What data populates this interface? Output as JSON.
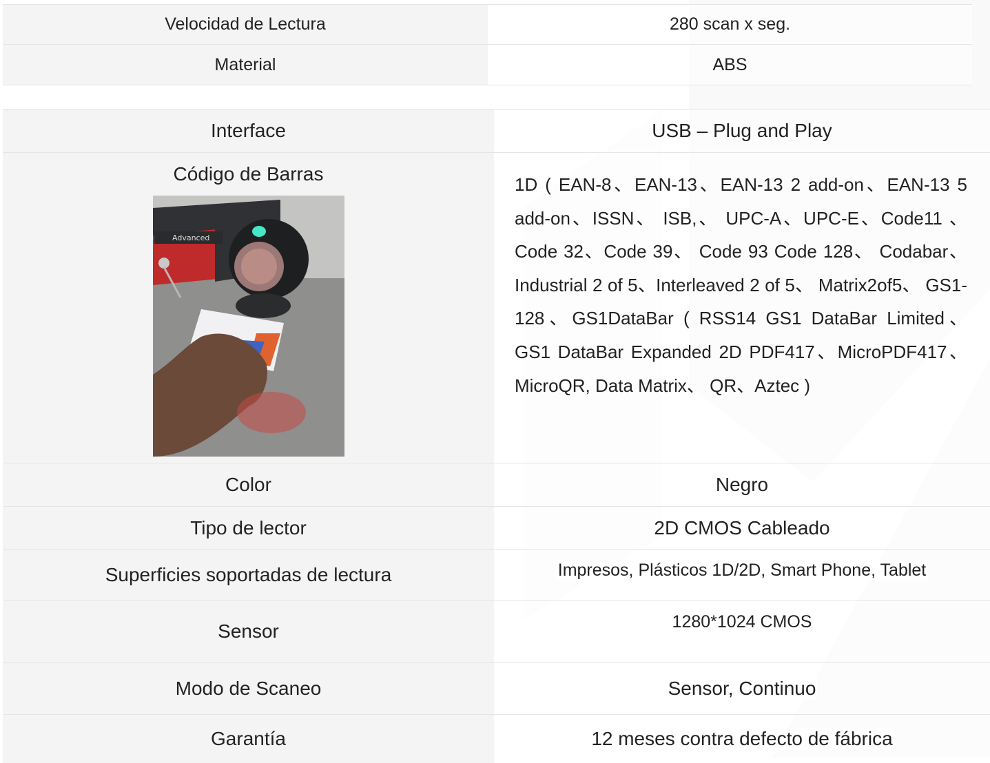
{
  "specs_top": [
    {
      "label": "Velocidad de Lectura",
      "value": "280 scan x seg."
    },
    {
      "label": "Material",
      "value": "ABS"
    }
  ],
  "specs": {
    "interface": {
      "label": "Interface",
      "value": "USB – Plug and Play"
    },
    "barcodes": {
      "label": "Código de Barras",
      "value": "1D ( EAN-8、EAN-13、EAN-13 2 add-on、EAN-13 5 add-on、ISSN、 ISB,、 UPC-A、UPC-E、Code11 、Code 32、Code 39、 Code 93 Code 128、 Codabar、Industrial 2 of 5、Interleaved 2 of 5、 Matrix2of5、 GS1-128、GS1DataBar ( RSS14 GS1 DataBar Limited、 GS1 DataBar Expanded 2D PDF417、MicroPDF417、MicroQR, Data Matrix、 QR、Aztec )",
      "photo_brand": "Advanced"
    },
    "color": {
      "label": "Color",
      "value": "Negro"
    },
    "reader_type": {
      "label": "Tipo de lector",
      "value": "2D CMOS Cableado"
    },
    "surfaces": {
      "label": "Superficies soportadas de lectura",
      "value": "Impresos, Plásticos 1D/2D, Smart Phone, Tablet"
    },
    "sensor": {
      "label": "Sensor",
      "value": "1280*1024 CMOS"
    },
    "scan_mode": {
      "label": "Modo de Scaneo",
      "value": "Sensor, Continuo"
    },
    "warranty": {
      "label": "Garantía",
      "value": "12 meses contra defecto de fábrica"
    }
  }
}
